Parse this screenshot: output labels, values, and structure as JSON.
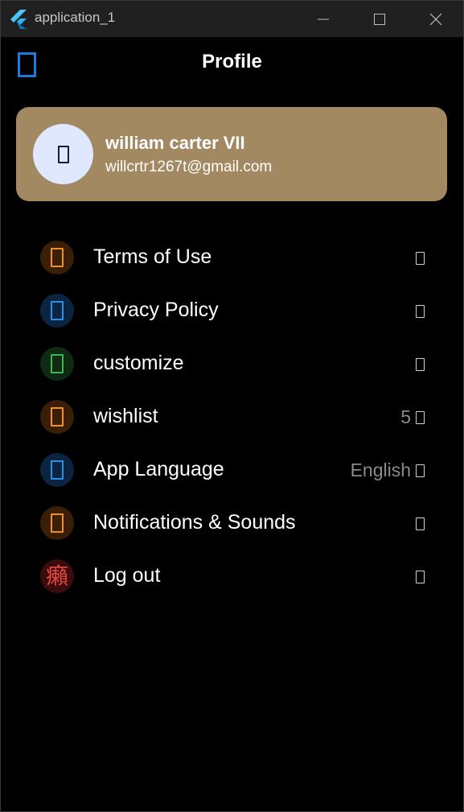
{
  "window": {
    "title": "application_1",
    "controls": {
      "minimize": "minimize",
      "maximize": "maximize",
      "close": "close"
    }
  },
  "appbar": {
    "title": "Profile",
    "back_icon": "back-arrow-icon"
  },
  "profile": {
    "name": "william carter VII",
    "email": "willcrtr1267t@gmail.com",
    "avatar_icon": "person-icon",
    "card_color": "#a38962"
  },
  "menu": [
    {
      "label": "Terms of Use",
      "icon": "document-icon",
      "accent": "#f0902a",
      "bg": "#3b1e06",
      "trailing": ""
    },
    {
      "label": "Privacy Policy",
      "icon": "lock-icon",
      "accent": "#2b8ee8",
      "bg": "#0b2440",
      "trailing": ""
    },
    {
      "label": "customize",
      "icon": "palette-icon",
      "accent": "#3fb54d",
      "bg": "#0f2a12",
      "trailing": ""
    },
    {
      "label": "wishlist",
      "icon": "heart-icon",
      "accent": "#f0902a",
      "bg": "#3b1e06",
      "trailing": "5"
    },
    {
      "label": "App Language",
      "icon": "language-icon",
      "accent": "#2b8ee8",
      "bg": "#0b2440",
      "trailing": "English"
    },
    {
      "label": "Notifications & Sounds",
      "icon": "bell-icon",
      "accent": "#f0902a",
      "bg": "#3b1e06",
      "trailing": ""
    },
    {
      "label": "Log out",
      "icon": "logout-icon",
      "accent": "#e84545",
      "bg": "#3a0c0c",
      "trailing": "",
      "glyph": "癩"
    }
  ]
}
